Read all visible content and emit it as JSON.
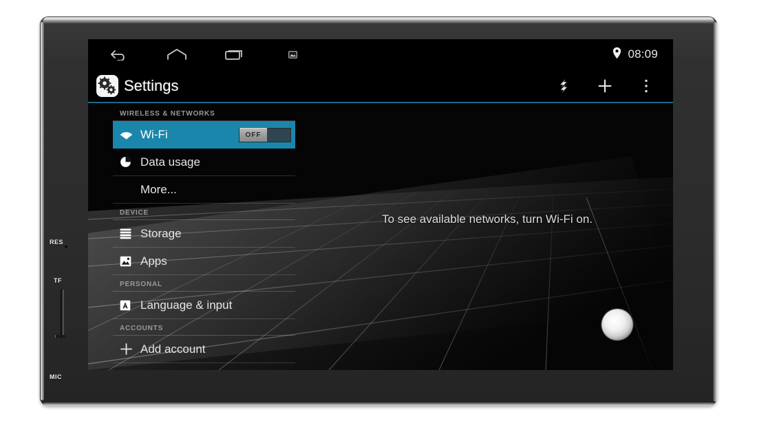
{
  "device": {
    "bezel_labels": [
      {
        "name": "res",
        "text": "RES"
      },
      {
        "name": "tf",
        "text": "TF"
      },
      {
        "name": "mic",
        "text": "MIC"
      }
    ]
  },
  "status_bar": {
    "nav": [
      {
        "name": "back-icon",
        "label": "back"
      },
      {
        "name": "home-icon",
        "label": "home"
      },
      {
        "name": "recents-icon",
        "label": "recent apps"
      },
      {
        "name": "screenshot-icon",
        "label": "screenshot"
      }
    ],
    "location_icon": "location-pin-icon",
    "clock": "08:09"
  },
  "action_bar": {
    "app_icon": "settings-gear-icon",
    "title": "Settings",
    "actions": [
      {
        "name": "sync-icon",
        "label": "sync"
      },
      {
        "name": "plus-icon",
        "label": "add"
      },
      {
        "name": "overflow-menu-icon",
        "label": "more options"
      }
    ]
  },
  "settings": {
    "sections": [
      {
        "header": "WIRELESS & NETWORKS",
        "rows": [
          {
            "label": "Wi-Fi",
            "icon": "wifi-icon",
            "selected": true,
            "toggle": "OFF"
          },
          {
            "label": "Data usage",
            "icon": "data-usage-icon",
            "selected": false
          },
          {
            "label": "More...",
            "icon": "",
            "selected": false
          }
        ]
      },
      {
        "header": "DEVICE",
        "rows": [
          {
            "label": "Storage",
            "icon": "storage-icon",
            "selected": false
          },
          {
            "label": "Apps",
            "icon": "apps-icon",
            "selected": false
          }
        ]
      },
      {
        "header": "PERSONAL",
        "rows": [
          {
            "label": "Language & input",
            "icon": "language-input-icon",
            "selected": false
          }
        ]
      },
      {
        "header": "ACCOUNTS",
        "rows": [
          {
            "label": "Add account",
            "icon": "plus-icon",
            "selected": false
          }
        ]
      }
    ]
  },
  "detail_pane": {
    "empty_message": "To see available networks, turn Wi-Fi on."
  },
  "colors": {
    "accent_blue": "#1b86ab",
    "divider_blue": "#1d6a8c",
    "screen_black": "#000000",
    "text_primary": "#e6e6e6",
    "text_secondary": "#9a9a9a"
  }
}
